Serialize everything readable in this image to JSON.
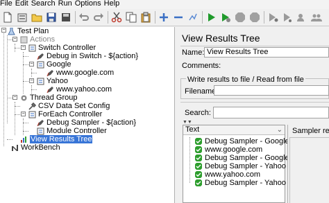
{
  "menu": [
    "File",
    "Edit",
    "Search",
    "Run",
    "Options",
    "Help"
  ],
  "toolbar": {
    "icons": [
      "new-icon",
      "templates-icon",
      "open-icon",
      "save-icon",
      "save-selection-icon",
      "undo-icon",
      "redo-icon",
      "cut-icon",
      "copy-icon",
      "paste-icon",
      "expand-icon",
      "collapse-icon",
      "toggle-icon",
      "start-icon",
      "start-no-pause-icon",
      "stop-icon",
      "shutdown-icon",
      "remote-start-icon",
      "remote-start-all-icon",
      "clear-icon",
      "clear-all-icon"
    ]
  },
  "tree": {
    "test_plan": "Test Plan",
    "actions": "Actions",
    "switch_controller": "Switch Controller",
    "debug_in_switch": "Debug in Switch - ${action}",
    "google": "Google",
    "google_url": "www.google.com",
    "yahoo": "Yahoo",
    "yahoo_url": "www.yahoo.com",
    "thread_group": "Thread Group",
    "csv_data_set": "CSV Data Set Config",
    "foreach_controller": "ForEach Controller",
    "debug_sampler": "Debug Sampler - ${action}",
    "module_controller": "Module Controller",
    "view_results_tree": "View Results Tree",
    "workbench": "WorkBench"
  },
  "panel": {
    "title": "View Results Tree",
    "name_label": "Name:",
    "name_value": "View Results Tree",
    "comments_label": "Comments:",
    "write_results_label": "Write results to file / Read from file",
    "filename_label": "Filename",
    "search_label": "Search:",
    "text_column": "Text",
    "sampler_result_tab": "Sampler resu"
  },
  "results": [
    "Debug Sampler - Google",
    "www.google.com",
    "Debug Sampler -  Google",
    "Debug Sampler - Yahoo",
    "www.yahoo.com",
    "Debug Sampler -  Yahoo"
  ],
  "colors": {
    "selection": "#3875d7",
    "success": "#2e9e2e",
    "start": "#1f9a2b"
  }
}
